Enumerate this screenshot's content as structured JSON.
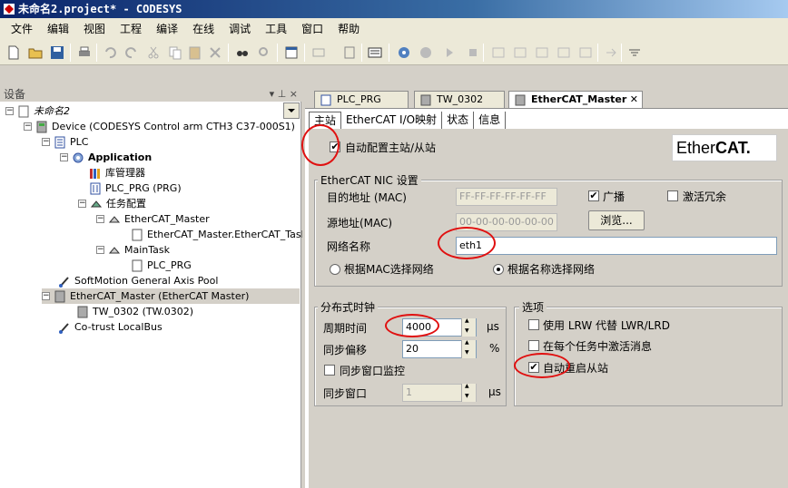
{
  "window": {
    "title": "未命名2.project* - CODESYS"
  },
  "menu": [
    "文件",
    "编辑",
    "视图",
    "工程",
    "编译",
    "在线",
    "调试",
    "工具",
    "窗口",
    "帮助"
  ],
  "devices_panel": {
    "title": "设备",
    "pin": "▾ ⊥ ×",
    "tree": [
      {
        "label": "未命名2",
        "italic": true
      },
      {
        "label": "Device (CODESYS Control arm CTH3 C37-000S1)"
      },
      {
        "label": "PLC"
      },
      {
        "label": "Application",
        "bold": true
      },
      {
        "label": "库管理器"
      },
      {
        "label": "PLC_PRG (PRG)"
      },
      {
        "label": "任务配置"
      },
      {
        "label": "EtherCAT_Master"
      },
      {
        "label": "EtherCAT_Master.EtherCAT_Task"
      },
      {
        "label": "MainTask"
      },
      {
        "label": "PLC_PRG"
      },
      {
        "label": "SoftMotion General Axis Pool"
      },
      {
        "label": "EtherCAT_Master (EtherCAT Master)"
      },
      {
        "label": "TW_0302 (TW.0302)"
      },
      {
        "label": "Co-trust LocalBus"
      }
    ]
  },
  "editor_tabs": [
    {
      "label": "PLC_PRG"
    },
    {
      "label": "TW_0302"
    },
    {
      "label": "EtherCAT_Master",
      "close": "✕"
    }
  ],
  "sub_tabs": [
    "主站",
    "EtherCAT I/O映射",
    "状态",
    "信息"
  ],
  "master": {
    "auto_config_label": "自动配置主站/从站",
    "auto_config_checked": true,
    "logo_text_a": "Ether",
    "logo_text_b": "CAT."
  },
  "nic": {
    "title": "EtherCAT NIC 设置",
    "dest_label": "目的地址 (MAC)",
    "dest_value": "FF-FF-FF-FF-FF-FF",
    "broadcast_label": "广播",
    "broadcast_checked": true,
    "redundancy_label": "激活冗余",
    "src_label": "源地址(MAC)",
    "src_value": "00-00-00-00-00-00",
    "browse_label": "浏览...",
    "netname_label": "网络名称",
    "netname_value": "eth1",
    "radio_mac_label": "根据MAC选择网络",
    "radio_name_label": "根据名称选择网络"
  },
  "dc": {
    "title": "分布式时钟",
    "cycle_label": "周期时间",
    "cycle_value": "4000",
    "cycle_unit": "μs",
    "sync_offset_label": "同步偏移",
    "sync_offset_value": "20",
    "sync_offset_unit": "%",
    "sync_window_monitor_label": "同步窗口监控",
    "sync_window_label": "同步窗口",
    "sync_window_value": "1",
    "sync_window_unit": "μs"
  },
  "options": {
    "title": "选项",
    "lrw_label": "使用 LRW 代替 LWR/LRD",
    "msg_label": "在每个任务中激活消息",
    "restart_label": "自动重启从站",
    "restart_checked": true
  },
  "colors": {
    "title_blue": "#0a246a",
    "highlight_red": "#e01010"
  }
}
